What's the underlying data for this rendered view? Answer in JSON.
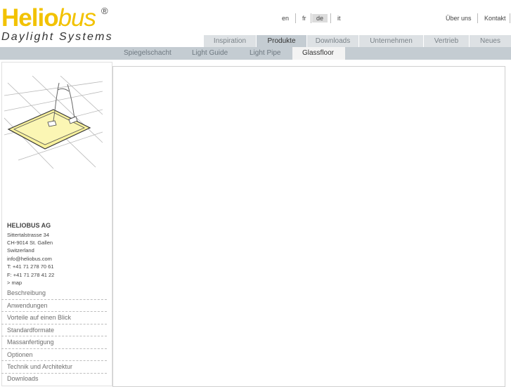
{
  "logo": {
    "part1": "Helio",
    "part2": "bus",
    "registered": "®",
    "tagline": "Daylight Systems"
  },
  "languages": [
    "en",
    "fr",
    "de",
    "it"
  ],
  "active_language": "de",
  "top_links": [
    "Über uns",
    "Kontakt"
  ],
  "main_tabs": [
    "Inspiration",
    "Produkte",
    "Downloads",
    "Unternehmen",
    "Vertrieb",
    "Neues"
  ],
  "active_tab": "Produkte",
  "sub_tabs": [
    "Spiegelschacht",
    "Light Guide",
    "Light Pipe",
    "Glassfloor"
  ],
  "active_sub_tab": "Glassfloor",
  "address": {
    "company": "HELIOBUS AG",
    "lines": [
      "Sittertalstrasse 34",
      "CH-9014 St. Gallen",
      "Switzerland",
      "info@heliobus.com",
      "T: +41 71 278 70 61",
      "F: +41 71 278 41 22",
      "> map"
    ]
  },
  "side_menu": [
    "Beschreibung",
    "Anwendungen",
    "Vorteile auf einen Blick",
    "Standardformate",
    "Massanfertigung",
    "Optionen",
    "Technik und Architektur",
    "Downloads"
  ],
  "colors": {
    "brand_yellow": "#f2c200",
    "nav_gray": "#c4ccd2",
    "tab_gray": "#dde1e4"
  }
}
